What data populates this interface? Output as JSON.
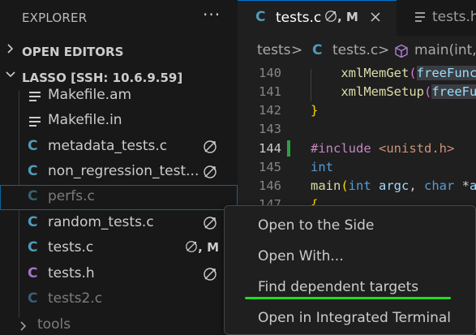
{
  "explorer": {
    "title": "EXPLORER",
    "more_label": "···",
    "open_editors_label": "OPEN EDITORS",
    "workspace_label": "LASSO [SSH: 10.6.9.59]",
    "files": [
      {
        "name": "Makefile.am",
        "icon": "lines-file-icon"
      },
      {
        "name": "Makefile.in",
        "icon": "lines-file-icon"
      },
      {
        "name": "metadata_tests.c",
        "icon": "C",
        "badge": "cmake-exclude-icon"
      },
      {
        "name": "non_regression_test...",
        "icon": "C",
        "badge": "cmake-exclude-icon"
      },
      {
        "name": "perfs.c",
        "icon": "C",
        "selected": true
      },
      {
        "name": "random_tests.c",
        "icon": "C",
        "badge": "cmake-exclude-icon"
      },
      {
        "name": "tests.c",
        "icon": "C",
        "badge": "cmake-exclude-icon",
        "status": "M"
      },
      {
        "name": "tests.h",
        "icon": "C",
        "badge": "cmake-exclude-icon"
      },
      {
        "name": "tests2.c",
        "icon": "C"
      }
    ],
    "folder_tools": "tools"
  },
  "tabs": [
    {
      "icon": "C",
      "label": "tests.c",
      "status": "M"
    },
    {
      "icon": "lines-file-icon",
      "label": "tests.h"
    }
  ],
  "breadcrumb": {
    "folder": "tests",
    "sep": ">",
    "file_icon": "C",
    "file": "tests.c",
    "symbol": "main(int,"
  },
  "code": {
    "lines": [
      {
        "num": "140",
        "text": "    xmlMemGet(freeFunc"
      },
      {
        "num": "141",
        "text": "    xmlMemSetup(freeFu"
      },
      {
        "num": "142",
        "text": "}"
      },
      {
        "num": "143",
        "text": ""
      },
      {
        "num": "144",
        "text": "#include <unistd.h>"
      },
      {
        "num": "145",
        "text": "int"
      },
      {
        "num": "146",
        "text": "main(int argc, char *a"
      },
      {
        "num": "147",
        "text": "{"
      }
    ]
  },
  "context_menu": {
    "items": [
      "Open to the Side",
      "Open With...",
      "Find dependent targets",
      "Open in Integrated Terminal"
    ]
  },
  "colors": {
    "accent": "#0078d4",
    "c_icon": "#519aba",
    "h_icon": "#a074c4",
    "highlight_underline": "#22dd22"
  }
}
